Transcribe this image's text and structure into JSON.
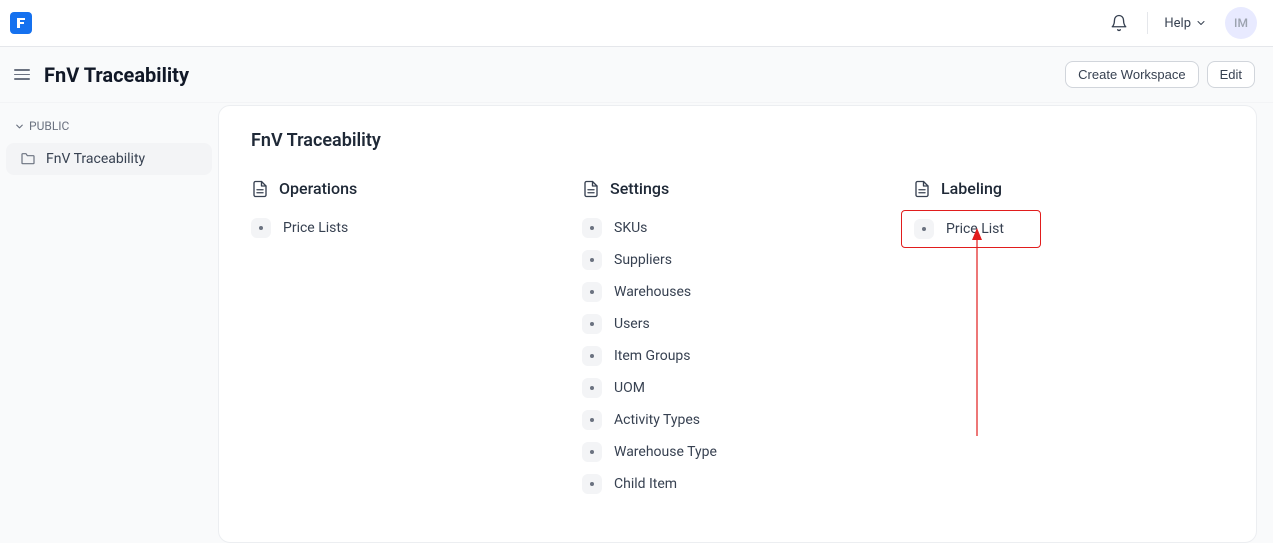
{
  "topbar": {
    "help_label": "Help",
    "avatar_initials": "IM"
  },
  "header": {
    "title": "FnV Traceability",
    "create_workspace": "Create Workspace",
    "edit": "Edit"
  },
  "sidebar": {
    "section_label": "PUBLIC",
    "items": [
      {
        "label": "FnV Traceability"
      }
    ]
  },
  "content": {
    "title": "FnV Traceability",
    "columns": [
      {
        "header": "Operations",
        "items": [
          "Price Lists"
        ]
      },
      {
        "header": "Settings",
        "items": [
          "SKUs",
          "Suppliers",
          "Warehouses",
          "Users",
          "Item Groups",
          "UOM",
          "Activity Types",
          "Warehouse Type",
          "Child Item"
        ]
      },
      {
        "header": "Labeling",
        "items": [
          "Price List"
        ]
      }
    ]
  }
}
